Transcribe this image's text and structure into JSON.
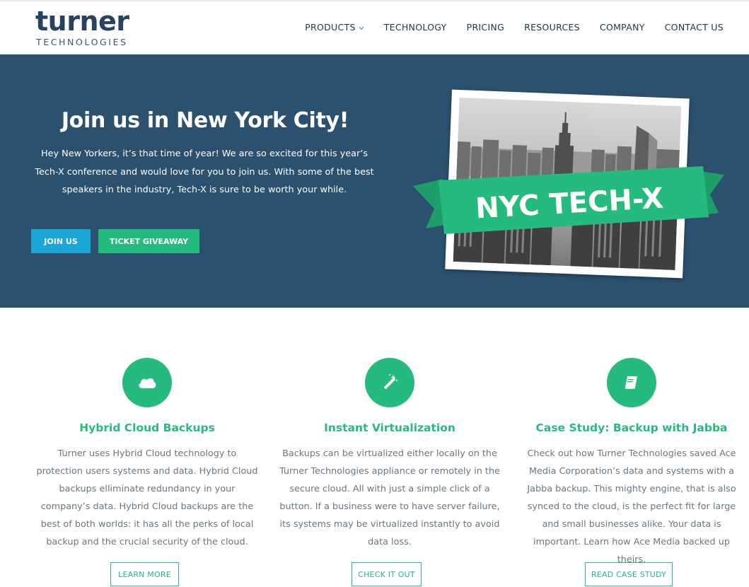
{
  "brand": {
    "name": "turner",
    "sub": "TECHNOLOGIES"
  },
  "nav": {
    "items": [
      {
        "label": "PRODUCTS",
        "has_dropdown": true
      },
      {
        "label": "TECHNOLOGY"
      },
      {
        "label": "PRICING"
      },
      {
        "label": "RESOURCES"
      },
      {
        "label": "COMPANY"
      },
      {
        "label": "CONTACT US"
      }
    ],
    "dropdown_icon": "chevron-down-icon"
  },
  "hero": {
    "title": "Join us in New York City!",
    "text": "Hey New Yorkers, it’s that time of year! We are so excited for this year’s Tech-X conference and would love for you to join us. With some of the best speakers in the industry, Tech-X is sure to be worth your while.",
    "join_label": "JOIN US",
    "giveaway_label": "TICKET GIVEAWAY",
    "banner_text": "NYC TECH-X",
    "colors": {
      "background": "#2b516f",
      "join": "#1aa6d6",
      "giveaway": "#26bb7e"
    }
  },
  "features": [
    {
      "icon": "cloud-icon",
      "title": "Hybrid Cloud Backups",
      "text": "Turner uses Hybrid Cloud technology to protection users systems and data.  Hybrid Cloud backups elliminate redundancy in your company’s data. Hybrid Cloud backups are the best of both worlds: it has all the perks of local backup and the crucial security of the cloud.",
      "button": "LEARN MORE"
    },
    {
      "icon": "magic-wand-icon",
      "title": "Instant Virtualization",
      "text": "Backups can be virtualized either locally on the Turner Technologies appliance or remotely in the secure cloud. All with just a simple click of a button. If a business were to have server failure, its systems may be virtualized instantly to avoid data loss.",
      "button": "CHECK IT OUT"
    },
    {
      "icon": "book-icon",
      "title": "Case Study: Backup with Jabba",
      "text": "Check out how Turner Technologies saved Ace Media Corporation’s data and systems with a Jabba backup. This mighty engine, that is also synced to the cloud, is the perfect fit for large and small businesses alike. Your data is important. Learn how Ace Media backed up theirs.",
      "button": "READ CASE STUDY"
    }
  ],
  "accent_color": "#26bb7e"
}
